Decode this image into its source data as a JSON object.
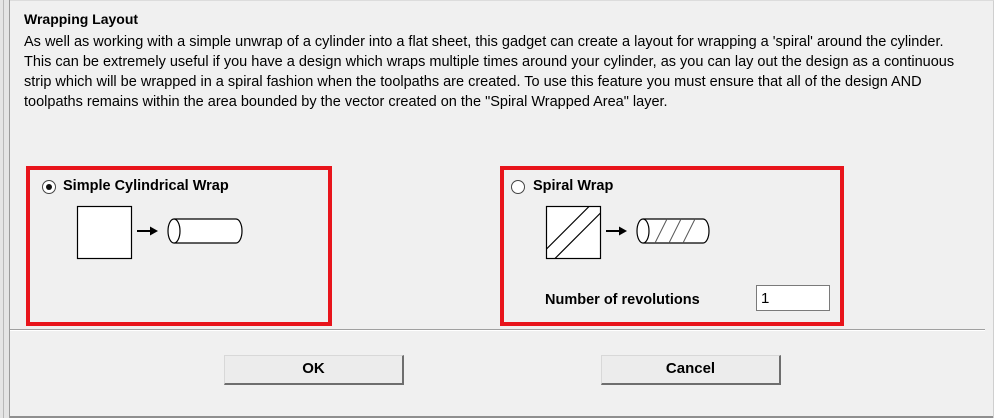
{
  "dialog": {
    "title": "Wrapping Layout",
    "description": "As well as working with a simple unwrap of a cylinder into a flat sheet, this gadget can create a layout for wrapping a 'spiral' around the cylinder. This can be extremely useful if you have a design which wraps multiple times around your cylinder, as you can lay out the design as a continuous strip which will be wrapped in a spiral fashion when the toolpaths are created. To use this feature you must ensure that all of the design AND toolpaths remains within the area bounded by the vector created on the \"Spiral Wrapped Area\" layer."
  },
  "options": {
    "simple": {
      "label": "Simple Cylindrical Wrap",
      "selected": true
    },
    "spiral": {
      "label": "Spiral Wrap",
      "selected": false
    }
  },
  "revolutions": {
    "label": "Number of revolutions",
    "value": "1"
  },
  "buttons": {
    "ok": "OK",
    "cancel": "Cancel"
  },
  "colors": {
    "highlight": "#e8141b",
    "dialog_bg": "#f0f0f0"
  }
}
